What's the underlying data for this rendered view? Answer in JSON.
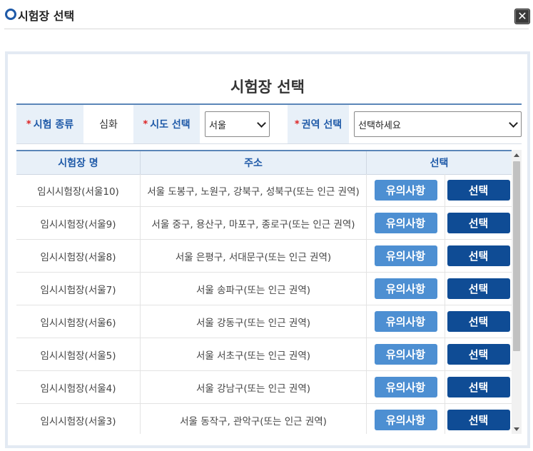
{
  "dialog": {
    "title": "시험장 선택",
    "close_label": "✕"
  },
  "panel": {
    "title": "시험장 선택"
  },
  "filter": {
    "required_mark": "*",
    "exam_type_label": "시험 종류",
    "exam_type_value": "심화",
    "region_label": "시도 선택",
    "region_value": "서울",
    "area_label": "권역 선택",
    "area_value": "선택하세요"
  },
  "table": {
    "headers": [
      "시험장 명",
      "주소",
      "선택"
    ],
    "note_button_label": "유의사항",
    "select_button_label": "선택",
    "rows": [
      {
        "name": "임시시험장(서울10)",
        "address": "서울 도봉구, 노원구, 강북구, 성북구(또는 인근 권역)"
      },
      {
        "name": "임시시험장(서울9)",
        "address": "서울 중구, 용산구, 마포구, 종로구(또는 인근 권역)"
      },
      {
        "name": "임시시험장(서울8)",
        "address": "서울 은평구, 서대문구(또는 인근 권역)"
      },
      {
        "name": "임시시험장(서울7)",
        "address": "서울 송파구(또는 인근 권역)"
      },
      {
        "name": "임시시험장(서울6)",
        "address": "서울 강동구(또는 인근 권역)"
      },
      {
        "name": "임시시험장(서울5)",
        "address": "서울 서초구(또는 인근 권역)"
      },
      {
        "name": "임시시험장(서울4)",
        "address": "서울 강남구(또는 인근 권역)"
      },
      {
        "name": "임시시험장(서울3)",
        "address": "서울 동작구, 관악구(또는 인근 권역)"
      }
    ]
  },
  "colors": {
    "accent": "#1f5aa8",
    "note_button": "#4d8fd2",
    "select_button": "#0f4c95",
    "header_bg": "#e8f0f8"
  }
}
